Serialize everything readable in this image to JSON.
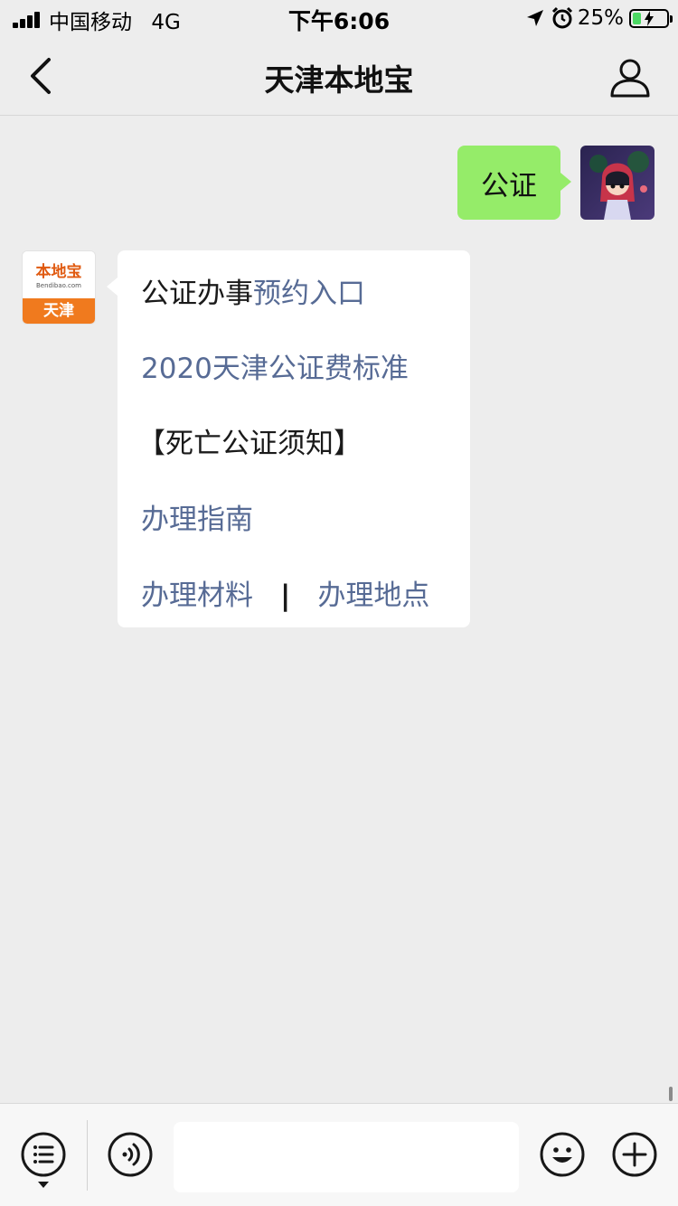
{
  "status_bar": {
    "carrier": "中国移动",
    "network": "4G",
    "time": "下午6:06",
    "battery_percent": "25%",
    "battery_level": 0.25,
    "icons": [
      "signal-icon",
      "location-arrow-icon",
      "alarm-icon",
      "battery-charging-icon"
    ]
  },
  "nav": {
    "title": "天津本地宝",
    "back_icon": "chevron-left-icon",
    "profile_icon": "person-icon"
  },
  "messages": {
    "sent": {
      "text": "公证"
    },
    "bot_avatar": {
      "logo_text": "本地宝",
      "url_text": "Bendibao.com",
      "city": "天津"
    },
    "received": {
      "line1_dark": "公证办事",
      "line1_link": "预约入口",
      "line2_link": "2020天津公证费标准",
      "line3_dark": "【死亡公证须知】",
      "line4_link": "办理指南",
      "line5_link_a": "办理材料",
      "line5_sep": "|",
      "line5_link_b": "办理地点"
    }
  },
  "input_bar": {
    "menu_icon": "menu-list-icon",
    "voice_icon": "voice-icon",
    "input_value": "",
    "emoji_icon": "emoji-icon",
    "add_icon": "plus-circle-icon"
  },
  "colors": {
    "background": "#ededed",
    "sent_bubble": "#95ec69",
    "link": "#576b95",
    "bot_orange": "#f07a1e",
    "battery_green": "#4cd964"
  }
}
